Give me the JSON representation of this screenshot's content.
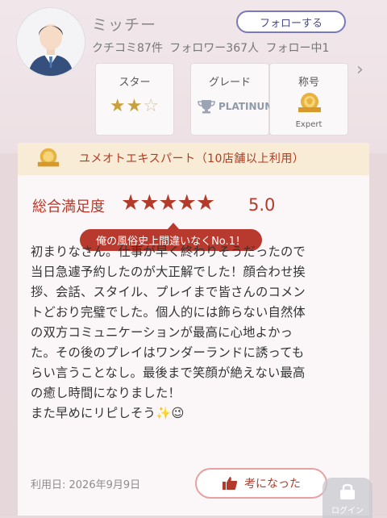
{
  "profile": {
    "username": "ミッチー",
    "follow_label": "フォローする",
    "stats": [
      "クチコミ87件",
      "フォロワー367人",
      "フォロー中1"
    ]
  },
  "cards": {
    "star_title": "スター",
    "star_rating": 2,
    "star_max": 3,
    "grade_title": "グレード",
    "grade_value": "PLATINUM",
    "rank_title": "称号",
    "rank_value": "Expert"
  },
  "banner": {
    "text": "ユメオトエキスパート（10店舗以上利用）"
  },
  "review": {
    "overall_label": "総合満足度",
    "stars": "★★★★★",
    "score": "5.0",
    "headline": "俺の風俗史上間違いなくNo.1！",
    "body": "初まりなさん。仕事が早く終わりそうだったので\n当日急遽予約したのが大正解でした！顔合わせ挨\n拶、会話、スタイル、プレイまで皆さんのコメン\nトどおり完璧でした。個人的には飾らない自然体\nの双方コミュニケーションが最高に心地よかっ\nた。その後のプレイはワンダーランドに誘っても\nらい言うことなし。最後まで笑顔が絶えない最高\nの癒し時間になりました！\nまた早めにリピしそう✨😉",
    "used_date": "利用日: 2026年9月9日",
    "helpful_label": "考になった"
  },
  "login": {
    "label": "ログイン"
  },
  "colors": {
    "accent_red": "#b43b2a",
    "follow_border": "#7a7ab8",
    "banner_bg": "#f8ecd6"
  }
}
